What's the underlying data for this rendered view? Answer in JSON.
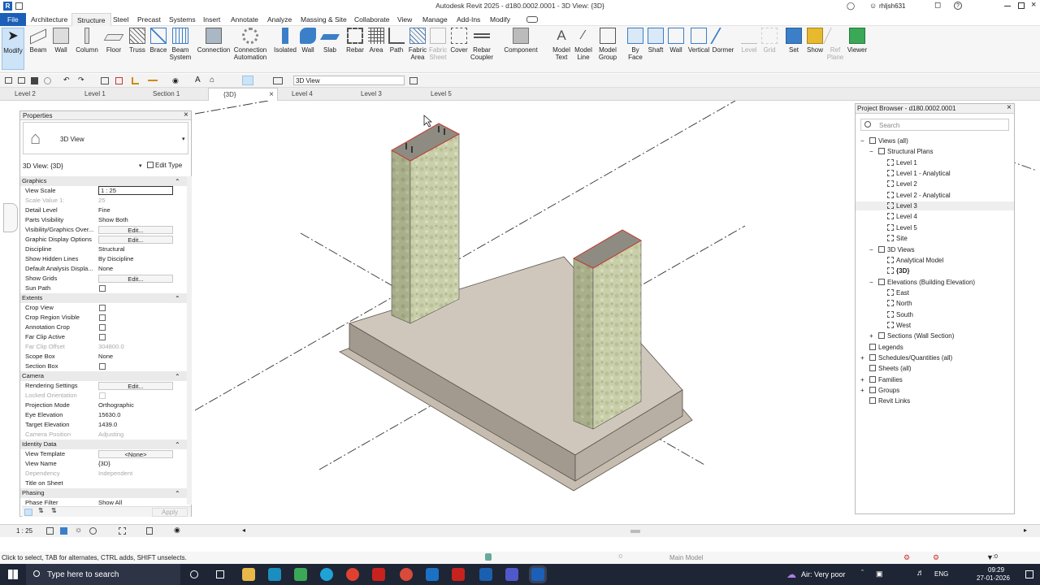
{
  "window": {
    "title": "Autodesk Revit 2025 - d180.0002.0001 - 3D View: {3D}",
    "user": "rhljsh631"
  },
  "menu": {
    "items": [
      "File",
      "Architecture",
      "Structure",
      "Steel",
      "Precast",
      "Systems",
      "Insert",
      "Annotate",
      "Analyze",
      "Massing & Site",
      "Collaborate",
      "View",
      "Manage",
      "Add-Ins",
      "Modify"
    ],
    "active": "Structure"
  },
  "ribbon": {
    "buttons": [
      "Modify",
      "Beam",
      "Wall",
      "Column",
      "Floor",
      "Truss",
      "Brace",
      "Beam System",
      "Connection",
      "Connection Automation",
      "Isolated",
      "Wall",
      "Slab",
      "Rebar",
      "Area",
      "Path",
      "Fabric Area",
      "Fabric Sheet",
      "Cover",
      "Rebar Coupler",
      "Component",
      "Model Text",
      "Model Line",
      "Model Group",
      "By Face",
      "Shaft",
      "Wall",
      "Vertical",
      "Dormer",
      "Level",
      "Grid",
      "Set",
      "Show",
      "Ref Plane",
      "Viewer"
    ]
  },
  "qat": {
    "view_selector": "3D View"
  },
  "tabs": [
    "Level 2",
    "Level 1",
    "Section 1",
    "{3D}",
    "Level 4",
    "Level 3",
    "Level 5"
  ],
  "properties": {
    "title": "Properties",
    "type_name": "3D View",
    "selector": "3D View: {3D}",
    "edit_type": "Edit Type",
    "apply": "Apply",
    "rows": [
      {
        "group": "Graphics"
      },
      {
        "k": "View Scale",
        "v": "1 : 25",
        "input": true
      },
      {
        "k": "Scale Value    1:",
        "v": "25",
        "dim": true
      },
      {
        "k": "Detail Level",
        "v": "Fine"
      },
      {
        "k": "Parts Visibility",
        "v": "Show Both"
      },
      {
        "k": "Visibility/Graphics Over...",
        "v": "Edit...",
        "btn": true
      },
      {
        "k": "Graphic Display Options",
        "v": "Edit...",
        "btn": true
      },
      {
        "k": "Discipline",
        "v": "Structural"
      },
      {
        "k": "Show Hidden Lines",
        "v": "By Discipline"
      },
      {
        "k": "Default Analysis Displa...",
        "v": "None"
      },
      {
        "k": "Show Grids",
        "v": "Edit...",
        "btn": true
      },
      {
        "k": "Sun Path",
        "chk": true
      },
      {
        "group": "Extents"
      },
      {
        "k": "Crop View",
        "chk": true
      },
      {
        "k": "Crop Region Visible",
        "chk": true
      },
      {
        "k": "Annotation Crop",
        "chk": true
      },
      {
        "k": "Far Clip Active",
        "chk": true
      },
      {
        "k": "Far Clip Offset",
        "v": "304800.0",
        "dim": true
      },
      {
        "k": "Scope Box",
        "v": "None"
      },
      {
        "k": "Section Box",
        "chk": true
      },
      {
        "group": "Camera"
      },
      {
        "k": "Rendering Settings",
        "v": "Edit...",
        "btn": true
      },
      {
        "k": "Locked Orientation",
        "chk": true,
        "dim": true
      },
      {
        "k": "Projection Mode",
        "v": "Orthographic"
      },
      {
        "k": "Eye Elevation",
        "v": "15630.0"
      },
      {
        "k": "Target Elevation",
        "v": "1439.0"
      },
      {
        "k": "Camera Position",
        "v": "Adjusting",
        "dim": true
      },
      {
        "group": "Identity Data"
      },
      {
        "k": "View Template",
        "v": "<None>",
        "btn": true
      },
      {
        "k": "View Name",
        "v": "{3D}"
      },
      {
        "k": "Dependency",
        "v": "Independent",
        "dim": true
      },
      {
        "k": "Title on Sheet",
        "v": ""
      },
      {
        "group": "Phasing"
      },
      {
        "k": "Phase Filter",
        "v": "Show All"
      }
    ]
  },
  "browser": {
    "title": "Project Browser - d180.0002.0001",
    "search": "Search",
    "items": [
      {
        "t": "Views (all)",
        "l": 0,
        "x": "-"
      },
      {
        "t": "Structural Plans",
        "l": 1,
        "x": "-"
      },
      {
        "t": "Level 1",
        "l": 2,
        "v": true
      },
      {
        "t": "Level 1 - Analytical",
        "l": 2,
        "v": true
      },
      {
        "t": "Level 2",
        "l": 2,
        "v": true
      },
      {
        "t": "Level 2 - Analytical",
        "l": 2,
        "v": true
      },
      {
        "t": "Level 3",
        "l": 2,
        "v": true,
        "sel": true
      },
      {
        "t": "Level 4",
        "l": 2,
        "v": true
      },
      {
        "t": "Level 5",
        "l": 2,
        "v": true
      },
      {
        "t": "Site",
        "l": 2,
        "v": true
      },
      {
        "t": "3D Views",
        "l": 1,
        "x": "-"
      },
      {
        "t": "Analytical Model",
        "l": 2,
        "v": true
      },
      {
        "t": "{3D}",
        "l": 2,
        "v": true,
        "bold": true
      },
      {
        "t": "Elevations (Building Elevation)",
        "l": 1,
        "x": "-"
      },
      {
        "t": "East",
        "l": 2,
        "v": true
      },
      {
        "t": "North",
        "l": 2,
        "v": true
      },
      {
        "t": "South",
        "l": 2,
        "v": true
      },
      {
        "t": "West",
        "l": 2,
        "v": true
      },
      {
        "t": "Sections (Wall Section)",
        "l": 1,
        "x": "+"
      },
      {
        "t": "Legends",
        "l": 0
      },
      {
        "t": "Schedules/Quantities (all)",
        "l": 0,
        "x": "+"
      },
      {
        "t": "Sheets (all)",
        "l": 0
      },
      {
        "t": "Families",
        "l": 0,
        "x": "+"
      },
      {
        "t": "Groups",
        "l": 0,
        "x": "+"
      },
      {
        "t": "Revit Links",
        "l": 0
      }
    ]
  },
  "status": {
    "scale": "1 : 25",
    "hint": "Click to select, TAB for alternates, CTRL adds, SHIFT unselects.",
    "model": "Main Model",
    "zero1": ":0",
    "zero2": ":0"
  },
  "taskbar": {
    "search": "Type here to search",
    "weather": "Air: Very poor",
    "lang": "ENG",
    "time": "09:29",
    "date": "27-01-2026"
  }
}
